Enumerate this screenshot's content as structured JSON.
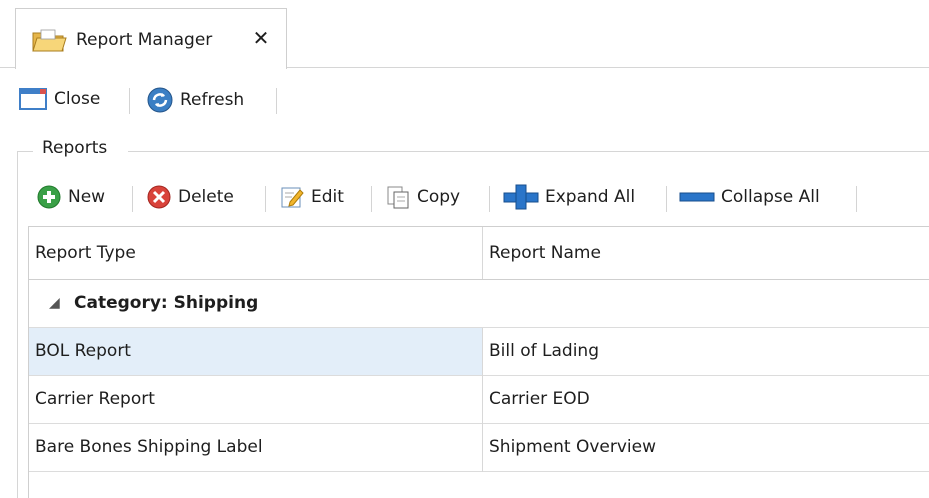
{
  "tab": {
    "title": "Report Manager",
    "close_glyph": "✕",
    "icon": "folder-open-icon"
  },
  "toolbar": {
    "close_label": "Close",
    "refresh_label": "Refresh"
  },
  "reports_group": {
    "label": "Reports",
    "actions": {
      "new_label": "New",
      "delete_label": "Delete",
      "edit_label": "Edit",
      "copy_label": "Copy",
      "expand_all_label": "Expand All",
      "collapse_all_label": "Collapse All"
    }
  },
  "grid": {
    "columns": [
      "Report Type",
      "Report Name"
    ],
    "group_header": "Category: Shipping",
    "group_arrow": "◢",
    "rows": [
      {
        "type": "BOL Report",
        "name": "Bill of Lading"
      },
      {
        "type": "Carrier Report",
        "name": "Carrier EOD"
      },
      {
        "type": "Bare Bones Shipping Label",
        "name": "Shipment Overview"
      }
    ],
    "selected_row_index": 0,
    "selected_color": "#e3eef9"
  }
}
